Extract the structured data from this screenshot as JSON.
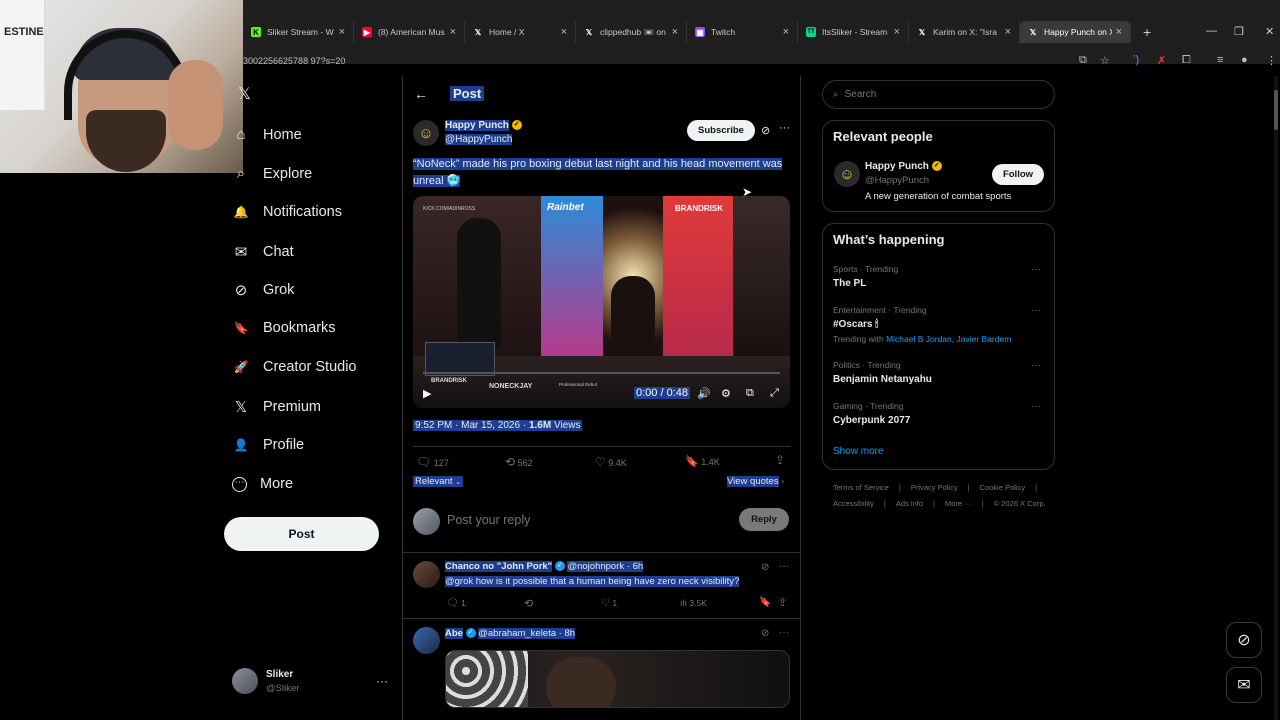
{
  "browser": {
    "tabs": [
      {
        "label": "Sliker Stream - W",
        "fav": "K",
        "fav_color": "#53fc18"
      },
      {
        "label": "(8) American Mus",
        "fav": "▶",
        "fav_color": "#ff0033"
      },
      {
        "label": "Home / X",
        "fav": "𝕏",
        "fav_color": "#1f1f1f"
      },
      {
        "label": "clippedhub 📼 on",
        "fav": "𝕏",
        "fav_color": "#1f1f1f"
      },
      {
        "label": "Twitch",
        "fav": "▣",
        "fav_color": "#9146ff"
      },
      {
        "label": "ItsSliker - Stream",
        "fav": "TT",
        "fav_color": "#0bd68a"
      },
      {
        "label": "Karim on X: \"Isra",
        "fav": "𝕏",
        "fav_color": "#1f1f1f"
      },
      {
        "label": "Happy Punch on X",
        "fav": "𝕏",
        "fav_color": "#1f1f1f"
      }
    ],
    "url": "3002256625788 97?s=20"
  },
  "webcam_poster_text": "ESTINE",
  "nav": {
    "items": [
      {
        "label": "Home",
        "icon": "⌂"
      },
      {
        "label": "Explore",
        "icon": "⌕"
      },
      {
        "label": "Notifications",
        "icon": "🔔"
      },
      {
        "label": "Chat",
        "icon": "✉"
      },
      {
        "label": "Grok",
        "icon": "⊘"
      },
      {
        "label": "Bookmarks",
        "icon": "🔖"
      },
      {
        "label": "Creator Studio",
        "icon": "🚀"
      },
      {
        "label": "Premium",
        "icon": "𝕏"
      },
      {
        "label": "Profile",
        "icon": "👤"
      },
      {
        "label": "More",
        "icon": "⋯"
      }
    ],
    "post_button": "Post",
    "user": {
      "name": "Sliker",
      "handle": "@Sliker"
    }
  },
  "header": {
    "title": "Post"
  },
  "post": {
    "author": "Happy Punch",
    "handle": "@HappyPunch",
    "subscribe": "Subscribe",
    "text": "“NoNeck” made his pro boxing debut last night and his head movement was unreal 🥶",
    "video": {
      "time": "0:00 / 0:48",
      "overlay_left": "KICK.COM/ADINROSS",
      "sponsor_1": "Rainbet",
      "sponsor_2": "BRANDRISK",
      "lower_third_name": "NONECKJAY",
      "lower_third_sub": "Professional Debut",
      "lower_third_tag": "BRANDRISK"
    },
    "timestamp": "9:52 PM · Mar 15, 2026 · ",
    "views_count": "1.6M",
    "views_label": " Views",
    "stats": {
      "replies": "127",
      "reposts": "562",
      "likes": "9.4K",
      "bookmarks": "1.4K"
    },
    "sort_label": "Relevant",
    "view_quotes": "View quotes",
    "reply_placeholder": "Post your reply",
    "reply_button": "Reply"
  },
  "replies": [
    {
      "author": "Chanco no \"John Pork\"",
      "handle": "@nojohnpork",
      "time": " · 6h",
      "text": "@grok how is it possible that a human being have zero neck visibility?",
      "replies": "1",
      "likes": "1",
      "views": "3.5K"
    },
    {
      "author": "Abe",
      "handle": "@abraham_keleta",
      "time": " · 8h"
    }
  ],
  "right": {
    "search_placeholder": "Search",
    "relevant_title": "Relevant people",
    "person": {
      "name": "Happy Punch",
      "handle": "@HappyPunch",
      "bio": "A new generation of combat sports",
      "follow": "Follow"
    },
    "happening_title": "What’s happening",
    "trends": [
      {
        "cat": "Sports · Trending",
        "title": "The PL"
      },
      {
        "cat": "Entertainment · Trending",
        "title": "#Oscars 🕯",
        "with_prefix": "Trending with ",
        "with": "Michael B Jordan, Javier Bardem"
      },
      {
        "cat": "Politics · Trending",
        "title": "Benjamin Netanyahu"
      },
      {
        "cat": "Gaming · Trending",
        "title": "Cyberpunk 2077"
      }
    ],
    "show_more": "Show more",
    "footer_row1": [
      "Terms of Service",
      "Privacy Policy",
      "Cookie Policy"
    ],
    "footer_row2": [
      "Accessibility",
      "Ads info",
      "More ···",
      "© 2026 X Corp."
    ]
  },
  "colors": {
    "accent": "#1d9bf0",
    "selection": "#1d3f8f",
    "gold_check": "#f0b90b"
  }
}
